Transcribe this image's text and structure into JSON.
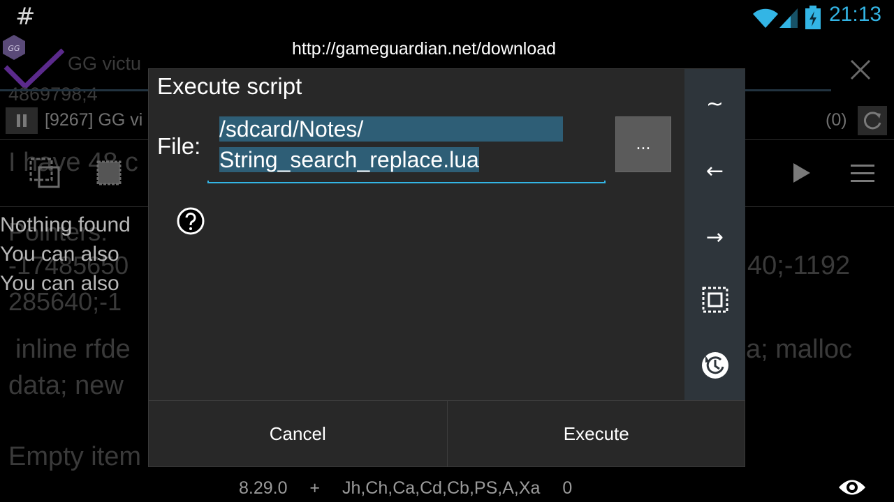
{
  "status_bar": {
    "notification_icon": "#",
    "time": "21:13",
    "icons": [
      "wifi-icon",
      "signal-icon",
      "battery-charging-icon"
    ]
  },
  "background_app": {
    "app_icon": "gg-logo",
    "title": "GG victu",
    "value_line": "4869798;4",
    "process": "[9267] GG vi",
    "counter": "(0)",
    "heading": "I have 48 c",
    "nothing_found": "Nothing found",
    "pointers": "Pointers:",
    "hint1": "You can also",
    "hint2": "You can also",
    "numbers1": "-17485650",
    "numbers1_right": "40;-1192",
    "numbers2": "285640;-1",
    "code1": "inline rfde",
    "code1_right": "a; malloc",
    "code2": "data; new",
    "empty": "Empty item"
  },
  "dialog": {
    "url": "http://gameguardian.net/download",
    "title": "Execute script",
    "file_label": "File:",
    "file_line1": "/sdcard/Notes/",
    "file_line2": "String_search_replace.lua",
    "browse_label": "...",
    "side_buttons": [
      {
        "label": "~",
        "icon": "tilde-icon"
      },
      {
        "label": "←",
        "icon": "arrow-left-icon"
      },
      {
        "label": "→",
        "icon": "arrow-right-icon"
      },
      {
        "label": "",
        "icon": "select-all-icon"
      },
      {
        "label": "",
        "icon": "history-icon"
      }
    ],
    "cancel_label": "Cancel",
    "execute_label": "Execute"
  },
  "bottom_bar": {
    "version": "8.29.0",
    "plus": "+",
    "regions": "Jh,Ch,Ca,Cd,Cb,PS,A,Xa",
    "count": "0"
  }
}
